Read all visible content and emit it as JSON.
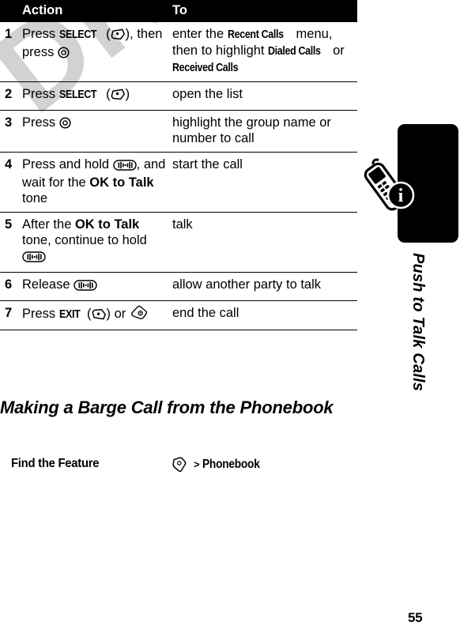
{
  "document": {
    "watermark": "DRAFT",
    "page_number": "55"
  },
  "side_tab": {
    "title": "Push to Talk Calls",
    "icon": "phone-info-icon"
  },
  "table": {
    "headers": {
      "num": "",
      "action": "Action",
      "to": "To"
    },
    "rows": [
      {
        "num": "1",
        "action_pre": "Press ",
        "action_kw": "SELECT",
        "action_mid": " (",
        "action_icon": "left-soft-key-icon",
        "action_post": "), then press ",
        "action_icon2": "navigation-key-icon",
        "to_pre": "enter the ",
        "to_kw1": "Recent Calls",
        "to_mid1": " menu, then to highlight ",
        "to_kw2": "Dialed Calls",
        "to_mid2": " or ",
        "to_kw3": "Received Calls"
      },
      {
        "num": "2",
        "action_pre": "Press ",
        "action_kw": "SELECT",
        "action_mid": " (",
        "action_icon": "left-soft-key-icon",
        "action_post": ")",
        "to_text": "open the list"
      },
      {
        "num": "3",
        "action_pre": "Press ",
        "action_icon": "navigation-key-icon",
        "to_text": "highlight the group name or number to call"
      },
      {
        "num": "4",
        "action_pre": "Press and hold ",
        "action_icon": "ptt-button-icon",
        "action_mid": ", and wait for the ",
        "action_kw": "OK to Talk",
        "action_post": " tone",
        "to_text": "start the call"
      },
      {
        "num": "5",
        "action_pre": "After the ",
        "action_kw": "OK to Talk",
        "action_mid": " tone, continue to hold ",
        "action_icon": "ptt-button-icon",
        "to_text": "talk"
      },
      {
        "num": "6",
        "action_pre": "Release ",
        "action_icon": "ptt-button-icon",
        "to_text": "allow another party to talk"
      },
      {
        "num": "7",
        "action_pre": "Press ",
        "action_kw": "EXIT",
        "action_mid": " (",
        "action_icon": "right-soft-key-icon",
        "action_post": ") or ",
        "action_icon2": "end-call-key-icon",
        "to_text": "end the call"
      }
    ]
  },
  "section": {
    "heading": "Making a Barge Call from the Phonebook"
  },
  "find_feature": {
    "label": "Find the Feature",
    "icon": "menu-key-icon",
    "separator": ">",
    "target": "Phonebook"
  }
}
